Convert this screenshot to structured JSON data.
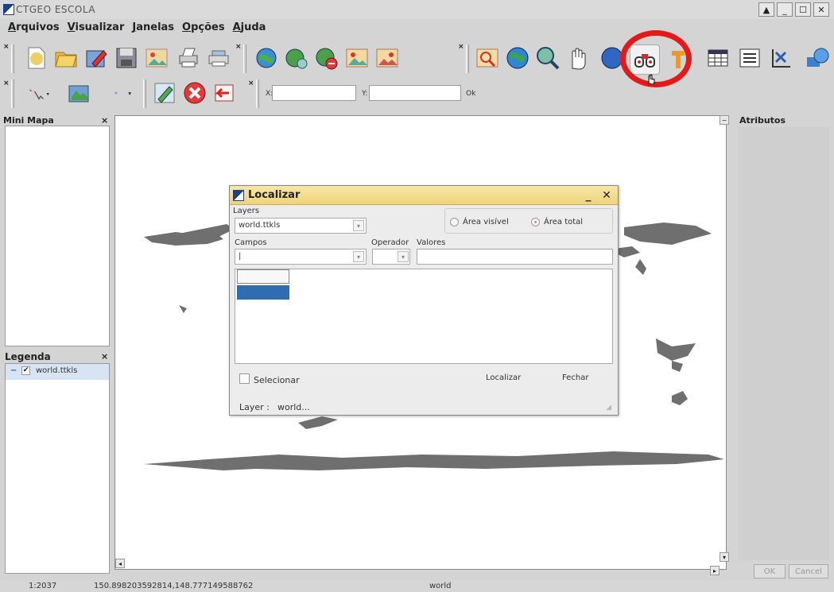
{
  "window": {
    "title": "CTGEO ESCOLA"
  },
  "menu": [
    "Arquivos",
    "Visualizar",
    "Janelas",
    "Opções",
    "Ajuda"
  ],
  "coords": {
    "x_label": "X:",
    "y_label": "Y:",
    "ok_label": "Ok",
    "x_value": "",
    "y_value": ""
  },
  "mini_map": {
    "title": "Mini Mapa",
    "close": "×"
  },
  "legend": {
    "title": "Legenda",
    "close": "×",
    "layer_name": "world.ttkls",
    "expand": "−"
  },
  "attributes": {
    "title": "Atributos",
    "ok": "OK",
    "cancel": "Cancel"
  },
  "dialog": {
    "title": "Localizar",
    "layers_label": "Layers",
    "layer_value": "world.ttkls",
    "radio_visible": "Área visível",
    "radio_total": "Área total",
    "campos_label": "Campos",
    "operador_label": "Operador",
    "valores_label": "Valores",
    "campos_value": "|",
    "select_label": "Selecionar",
    "localizar_button": "Localizar",
    "fechar_button": "Fechar",
    "layer_info_label": "Layer :",
    "layer_info_value": "world..."
  },
  "status": {
    "scale": "1:2037",
    "coordinates": "150.898203592814,148.777149588762",
    "layer": "world"
  },
  "colors": {
    "highlight": "#e41a1a",
    "title_bar": "#efd47c",
    "selection": "#2f6db0",
    "land": "#6f6f6f"
  }
}
